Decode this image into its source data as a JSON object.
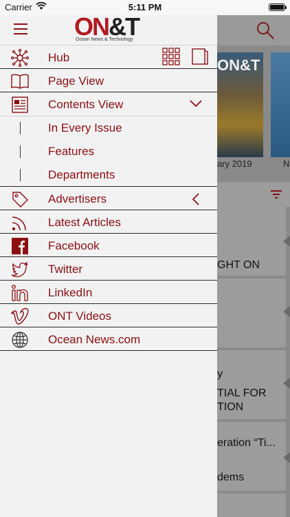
{
  "status": {
    "carrier": "Carrier",
    "time": "5:11 PM"
  },
  "brand": {
    "logo_main": "ON",
    "logo_amp": "&T",
    "logo_sub": "Ocean News & Technology"
  },
  "menu": {
    "items": [
      {
        "label": "Hub",
        "icon": "hub-network-icon"
      },
      {
        "label": "Page View",
        "icon": "open-book-icon"
      },
      {
        "label": "Contents View",
        "icon": "contents-icon"
      },
      {
        "label": "Advertisers",
        "icon": "tag-icon"
      },
      {
        "label": "Latest Articles",
        "icon": "rss-icon"
      },
      {
        "label": "Facebook",
        "icon": "facebook-icon"
      },
      {
        "label": "Twitter",
        "icon": "twitter-icon"
      },
      {
        "label": "LinkedIn",
        "icon": "linkedin-icon"
      },
      {
        "label": "ONT Videos",
        "icon": "vimeo-icon"
      },
      {
        "label": "Ocean News.com",
        "icon": "globe-icon"
      }
    ],
    "contents_sub": [
      "In Every Issue",
      "Features",
      "Departments"
    ]
  },
  "background": {
    "date1": "ary 2019",
    "date2": "N",
    "thumb_logo": "ON&T",
    "cards": [
      "GHT ON",
      "y",
      "TIAL FOR",
      "TION",
      "eration “Ti...",
      "dems"
    ]
  },
  "colors": {
    "accent": "#8c0f12",
    "brand_red": "#b01b22"
  }
}
